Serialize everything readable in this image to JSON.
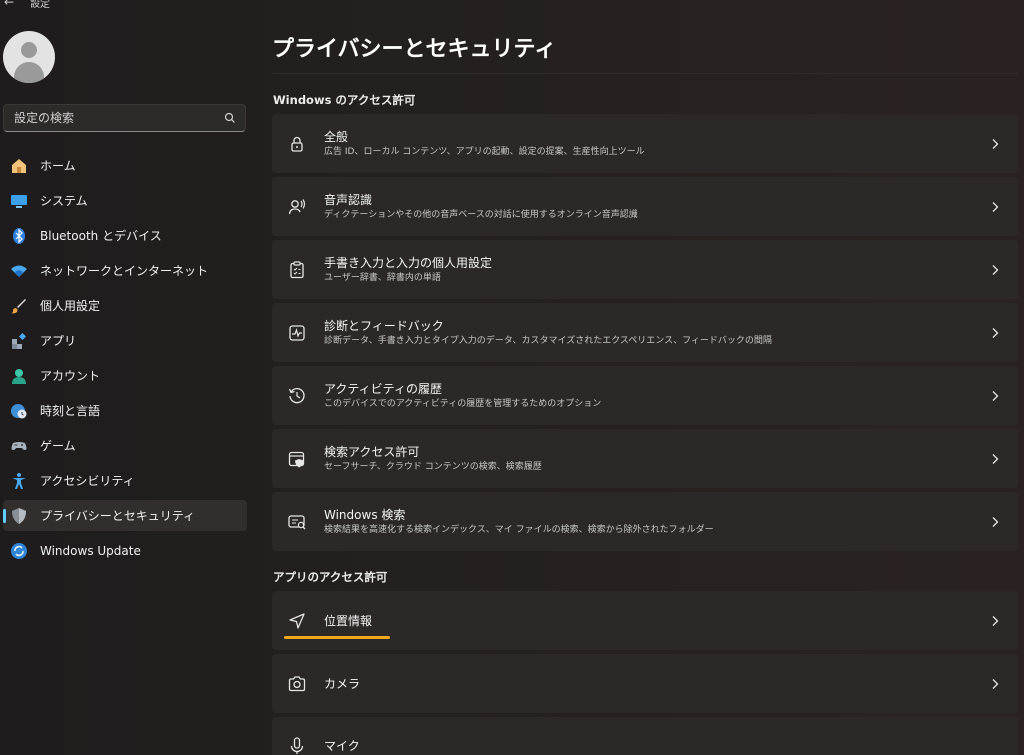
{
  "window": {
    "title": "設定"
  },
  "sidebar": {
    "search": {
      "placeholder": "設定の検索"
    },
    "items": [
      {
        "label": "ホーム",
        "icon": "home-icon"
      },
      {
        "label": "システム",
        "icon": "system-icon"
      },
      {
        "label": "Bluetooth とデバイス",
        "icon": "bluetooth-icon"
      },
      {
        "label": "ネットワークとインターネット",
        "icon": "wifi-icon"
      },
      {
        "label": "個人用設定",
        "icon": "brush-icon"
      },
      {
        "label": "アプリ",
        "icon": "apps-icon"
      },
      {
        "label": "アカウント",
        "icon": "account-icon"
      },
      {
        "label": "時刻と言語",
        "icon": "globe-clock-icon"
      },
      {
        "label": "ゲーム",
        "icon": "gamepad-icon"
      },
      {
        "label": "アクセシビリティ",
        "icon": "accessibility-icon"
      },
      {
        "label": "プライバシーとセキュリティ",
        "icon": "shield-icon",
        "selected": true
      },
      {
        "label": "Windows Update",
        "icon": "update-icon"
      }
    ]
  },
  "main": {
    "title": "プライバシーとセキュリティ",
    "sections": [
      {
        "heading": "Windows のアクセス許可",
        "cards": [
          {
            "title": "全般",
            "subtitle": "広告 ID、ローカル コンテンツ、アプリの起動、設定の提案、生産性向上ツール",
            "icon": "lock-icon"
          },
          {
            "title": "音声認識",
            "subtitle": "ディクテーションやその他の音声ベースの対話に使用するオンライン音声認識",
            "icon": "speech-icon"
          },
          {
            "title": "手書き入力と入力の個人用設定",
            "subtitle": "ユーザー辞書、辞書内の単語",
            "icon": "clipboard-icon"
          },
          {
            "title": "診断とフィードバック",
            "subtitle": "診断データ、手書き入力とタイプ入力のデータ、カスタマイズされたエクスペリエンス、フィードバックの間隔",
            "icon": "diagnostics-icon"
          },
          {
            "title": "アクティビティの履歴",
            "subtitle": "このデバイスでのアクティビティの履歴を管理するためのオプション",
            "icon": "history-icon"
          },
          {
            "title": "検索アクセス許可",
            "subtitle": "セーフサーチ、クラウド コンテンツの検索、検索履歴",
            "icon": "search-permissions-icon"
          },
          {
            "title": "Windows 検索",
            "subtitle": "検索結果を高速化する検索インデックス、マイ ファイルの検索、検索から除外されたフォルダー",
            "icon": "windows-search-icon"
          }
        ]
      },
      {
        "heading": "アプリのアクセス許可",
        "cards": [
          {
            "title": "位置情報",
            "subtitle": "",
            "icon": "location-icon",
            "highlighted": true
          },
          {
            "title": "カメラ",
            "subtitle": "",
            "icon": "camera-icon"
          },
          {
            "title": "マイク",
            "subtitle": "",
            "icon": "microphone-icon"
          }
        ]
      }
    ]
  },
  "colors": {
    "accent": "#60cdff",
    "highlight": "#f2a81d",
    "card": "#2c2828"
  }
}
